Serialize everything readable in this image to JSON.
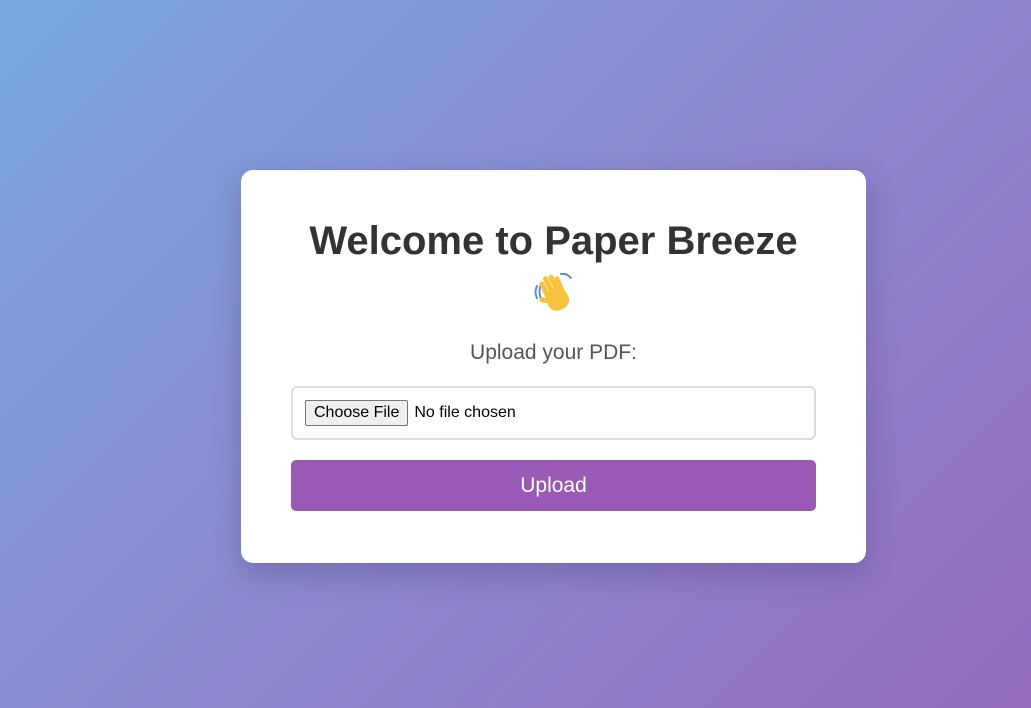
{
  "card": {
    "title": "Welcome to Paper Breeze",
    "emoji_icon": "waving-hand-icon",
    "upload_label": "Upload your PDF:",
    "file_input": {
      "button_label": "Choose File",
      "status_text": "No file chosen"
    },
    "upload_button_label": "Upload"
  },
  "colors": {
    "accent": "#9b59b6",
    "gradient_start": "#78a8de",
    "gradient_end": "#956cbe",
    "title_text": "#333333",
    "label_text": "#555555"
  }
}
